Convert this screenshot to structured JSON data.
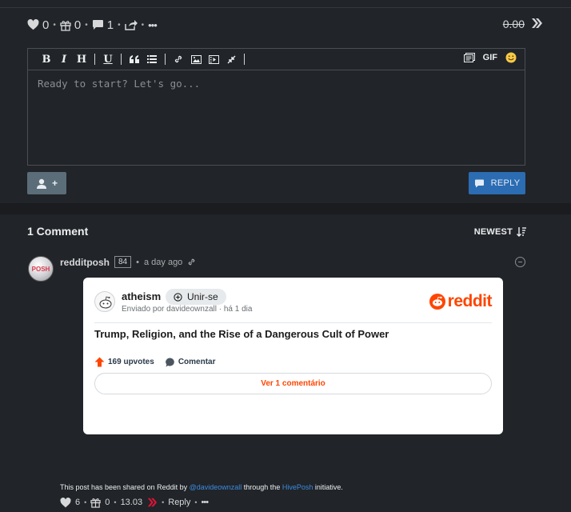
{
  "post_actions": {
    "likes": "0",
    "gifts": "0",
    "comments": "1",
    "payout": "0.00"
  },
  "editor": {
    "toolbar": {
      "bold": "B",
      "italic": "I",
      "heading": "H",
      "underline": "U",
      "gif": "GIF"
    },
    "placeholder": "Ready to start? Let's go..."
  },
  "buttons": {
    "add_user": "+",
    "reply": "REPLY"
  },
  "comments": {
    "count_label": "1 Comment",
    "sort_label": "NEWEST"
  },
  "comment": {
    "avatar_text": "POSH",
    "author": "redditposh",
    "reputation": "84",
    "time": "a day ago",
    "embed": {
      "subreddit": "atheism",
      "join_label": "Unir-se",
      "posted_by": "Enviado por davideownzall · há 1 dia",
      "logo_text": "reddit",
      "title": "Trump, Religion, and the Rise of a Dangerous Cult of Power",
      "upvotes": "169 upvotes",
      "comment_label": "Comentar",
      "view_label": "Ver 1 comentário"
    },
    "share_note": {
      "prefix": "This post has been shared on Reddit by ",
      "user": "@davideownzall",
      "middle": " through the ",
      "project": "HivePosh",
      "suffix": " initiative."
    },
    "actions": {
      "likes": "6",
      "gifts": "0",
      "payout": "13.03",
      "reply_label": "Reply"
    }
  },
  "colors": {
    "background": "#212428",
    "reply_button": "#2c6cb2",
    "reddit_orange": "#ff4500",
    "link_blue": "#3c8be0",
    "hive_red": "#e31337"
  },
  "icons": [
    "heart-icon",
    "gift-icon",
    "comment-icon",
    "share-icon",
    "more-icon",
    "hive-icon",
    "quote-icon",
    "list-icon",
    "link-icon",
    "image-icon",
    "video-icon",
    "collapse-icon",
    "snippet-icon",
    "emoji-icon",
    "add-user-icon",
    "chat-icon",
    "sort-icon",
    "minus-circle-icon",
    "upvote-icon"
  ]
}
